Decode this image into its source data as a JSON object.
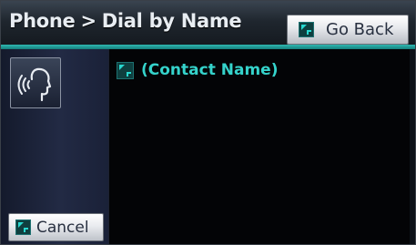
{
  "header": {
    "title_part1": "Phone",
    "separator": ">",
    "title_part2": "Dial by Name",
    "go_back_label": "Go Back"
  },
  "left_panel": {
    "voice_icon": "voice-recognition-icon",
    "cancel_label": "Cancel"
  },
  "list": {
    "items": [
      {
        "label": "(Contact Name)",
        "icon": "contact-entry-icon"
      }
    ]
  },
  "colors": {
    "accent_teal": "#2fb7b1",
    "contact_text": "#35d3cb",
    "background": "#05070a",
    "panel_blue": "#222a44"
  }
}
